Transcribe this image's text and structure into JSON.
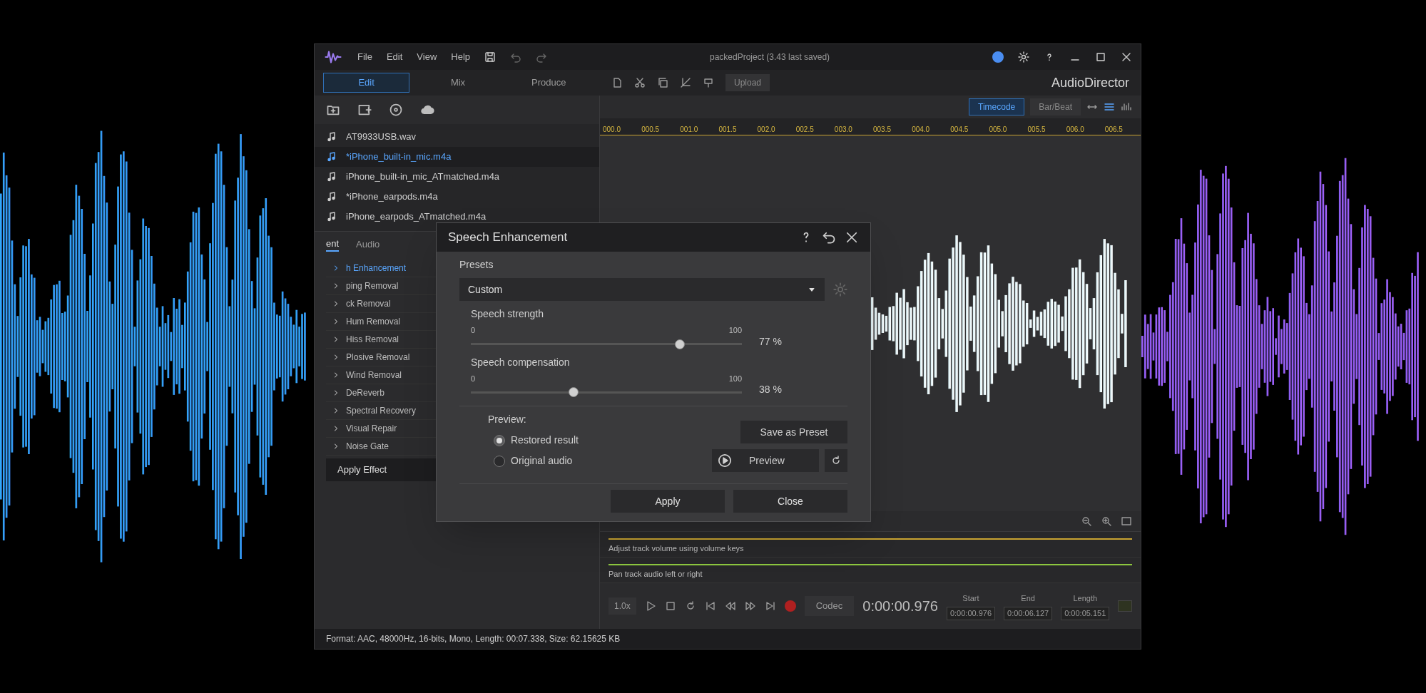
{
  "menu": [
    "File",
    "Edit",
    "View",
    "Help"
  ],
  "mode_tabs": [
    {
      "label": "Edit",
      "selected": true
    },
    {
      "label": "Mix",
      "selected": false
    },
    {
      "label": "Produce",
      "selected": false
    }
  ],
  "files": [
    {
      "name": "AT9933USB.wav",
      "selected": false
    },
    {
      "name": "*iPhone_built-in_mic.m4a",
      "selected": true
    },
    {
      "name": "iPhone_built-in_mic_ATmatched.m4a",
      "selected": false
    },
    {
      "name": "*iPhone_earpods.m4a",
      "selected": false
    },
    {
      "name": "iPhone_earpods_ATmatched.m4a",
      "selected": false
    }
  ],
  "effects_panel": {
    "tabs": [
      {
        "label": "ent",
        "selected": true
      },
      {
        "label": "Audio",
        "selected": false
      }
    ],
    "items": [
      {
        "label": "h Enhancement",
        "selected": true
      },
      {
        "label": "ping Removal",
        "selected": false
      },
      {
        "label": "ck Removal",
        "selected": false
      },
      {
        "label": "Hum Removal",
        "selected": false
      },
      {
        "label": "Hiss Removal",
        "selected": false
      },
      {
        "label": "Plosive Removal",
        "selected": false
      },
      {
        "label": "Wind Removal",
        "selected": false
      },
      {
        "label": "DeReverb",
        "selected": false
      },
      {
        "label": "Spectral Recovery",
        "selected": false
      },
      {
        "label": "Visual Repair",
        "selected": false
      },
      {
        "label": "Noise Gate",
        "selected": false
      }
    ],
    "apply_button": "Apply Effect"
  },
  "editor": {
    "project_title": "packedProject (3.43 last saved)",
    "upload_button": "Upload",
    "brand": "AudioDirector",
    "time_modes": [
      {
        "label": "Timecode",
        "selected": true
      },
      {
        "label": "Bar/Beat",
        "selected": false
      }
    ],
    "ruler": [
      "000.0",
      "000.5",
      "001.0",
      "001.5",
      "002.0",
      "002.5",
      "003.0",
      "003.5",
      "004.0",
      "004.5",
      "005.0",
      "005.5",
      "006.0",
      "006.5"
    ]
  },
  "tracks": [
    {
      "label": "Adjust track volume using volume keys",
      "color": "#c9a431"
    },
    {
      "label": "Pan track audio left or right",
      "color": "#8dc63f"
    }
  ],
  "transport": {
    "speed": "1.0x",
    "codec": "Codec",
    "time": "0:00:00.976",
    "fields": [
      {
        "label": "Start",
        "value": "0:00:00.976"
      },
      {
        "label": "End",
        "value": "0:00:06.127"
      },
      {
        "label": "Length",
        "value": "0:00:05.151"
      }
    ]
  },
  "status_bar": "Format: AAC, 48000Hz, 16-bits, Mono, Length: 00:07.338, Size: 62.15625 KB",
  "dialog": {
    "title": "Speech Enhancement",
    "presets_label": "Presets",
    "preset": "Custom",
    "sliders": [
      {
        "label": "Speech strength",
        "min": "0",
        "max": "100",
        "level": 0.77,
        "reading": "77 %"
      },
      {
        "label": "Speech compensation",
        "min": "0",
        "max": "100",
        "level": 0.38,
        "reading": "38 %"
      }
    ],
    "preview_label": "Preview:",
    "options": [
      {
        "label": "Restored result",
        "selected": true
      },
      {
        "label": "Original audio",
        "selected": false
      }
    ],
    "save_preset_button": "Save as Preset",
    "preview_button": "Preview",
    "apply_button": "Apply",
    "close_button": "Close"
  }
}
